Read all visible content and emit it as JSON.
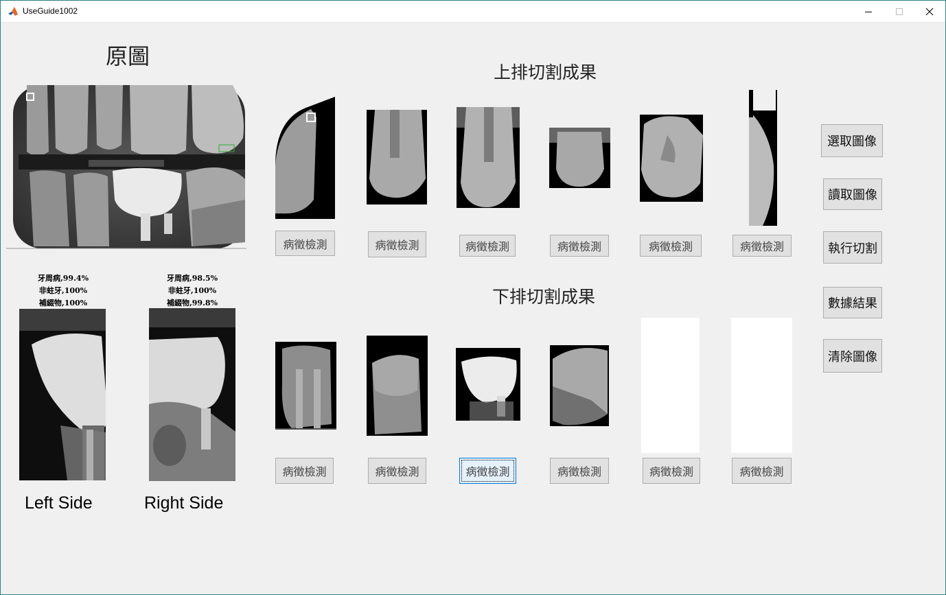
{
  "window": {
    "title": "UseGuide1002"
  },
  "original": {
    "title": "原圖"
  },
  "upper": {
    "title": "上排切割成果",
    "detect_labels": [
      "病徵檢測",
      "病徵檢測",
      "病徵檢測",
      "病徵檢測",
      "病徵檢測",
      "病徵檢測"
    ]
  },
  "lower": {
    "title": "下排切割成果",
    "detect_labels": [
      "病徵檢測",
      "病徵檢測",
      "病徵檢測",
      "病徵檢測",
      "病徵檢測",
      "病徵檢測"
    ]
  },
  "left_result": {
    "lines": [
      "牙周病,99.4%",
      "非蛀牙,100%",
      "補綴物,100%"
    ],
    "caption": "Left Side"
  },
  "right_result": {
    "lines": [
      "牙周病,98.5%",
      "非蛀牙,100%",
      "補綴物,99.8%"
    ],
    "caption": "Right Side"
  },
  "side_buttons": [
    "選取圖像",
    "讀取圖像",
    "執行切割",
    "數據結果",
    "清除圖像"
  ],
  "colors": {
    "background": "#f0f0f0",
    "button": "#e1e1e1",
    "button_border": "#adadad",
    "focus_border": "#0078d7",
    "window_border": "#2a7f8a"
  },
  "icons": {
    "app": "matlab-icon",
    "minimize": "minimize-icon",
    "maximize": "maximize-icon",
    "close": "close-icon"
  }
}
